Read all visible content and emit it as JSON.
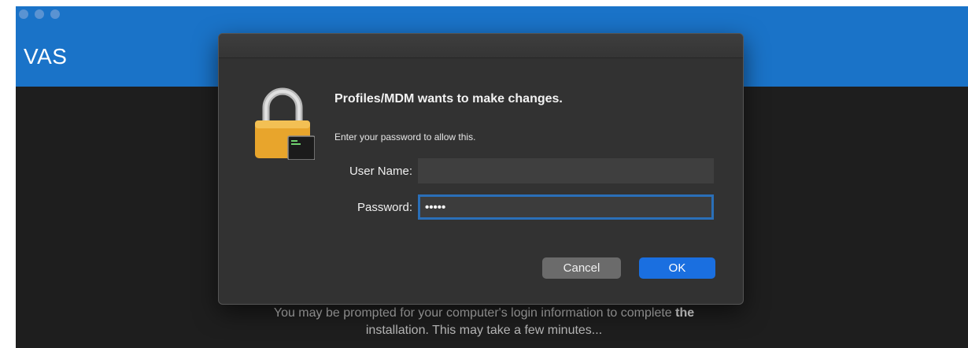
{
  "app": {
    "title": "VAS"
  },
  "dialog": {
    "heading": "Profiles/MDM wants to make changes.",
    "subtext": "Enter your password to allow this.",
    "username_label": "User Name:",
    "username_value": "",
    "password_label": "Password:",
    "password_value": "•••••",
    "cancel_label": "Cancel",
    "ok_label": "OK"
  },
  "footer": {
    "message_part1": "You may be prompted for your computer's login information to complete ",
    "message_bold": "the",
    "message_line2": "installation. This may take a few minutes..."
  },
  "icons": {
    "lock": "lock-icon",
    "terminal": "terminal-icon"
  },
  "colors": {
    "header_blue": "#1a73c8",
    "ok_blue": "#1a6fe0",
    "focus_ring": "#2a6fb8",
    "lock_gold": "#e8a52c"
  }
}
